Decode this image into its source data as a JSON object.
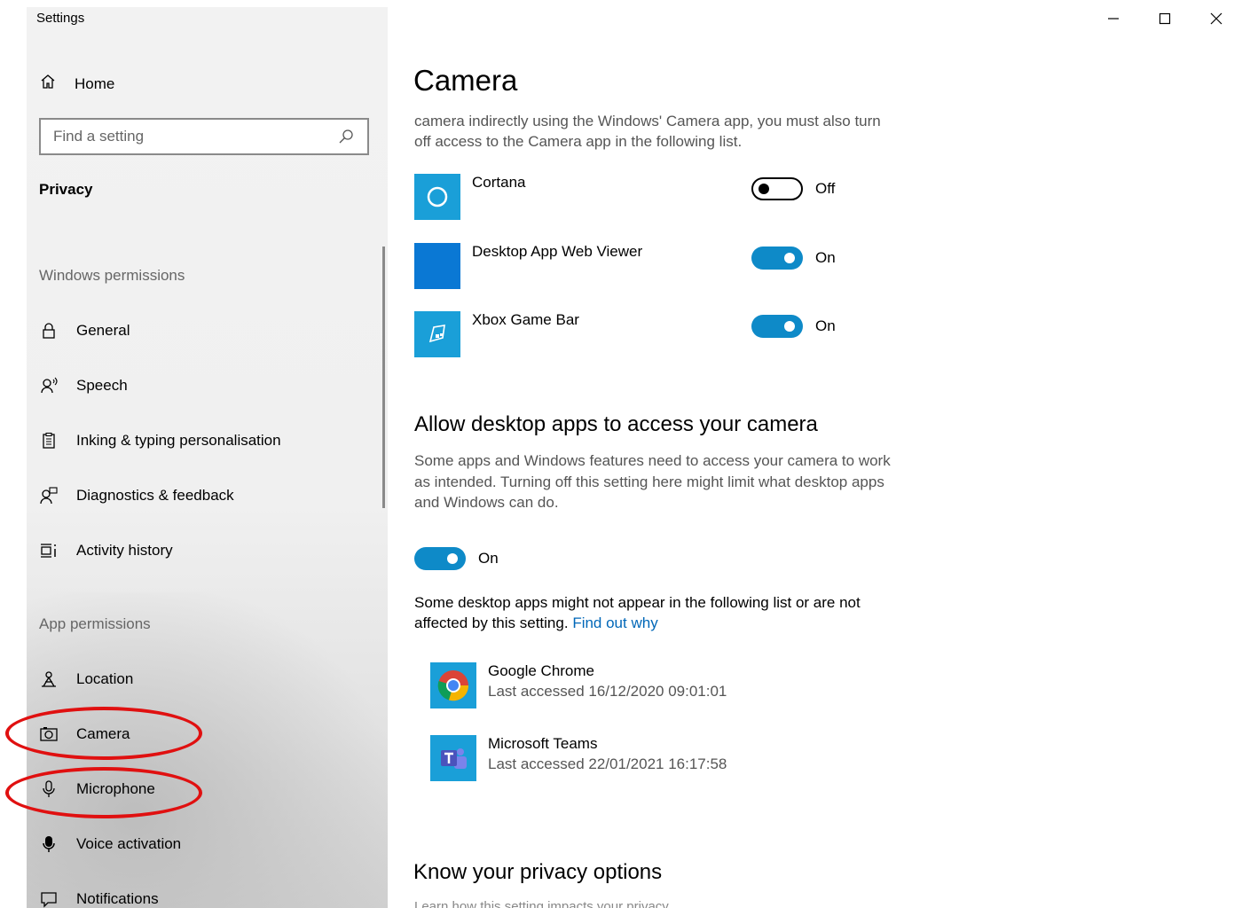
{
  "window": {
    "title": "Settings",
    "controls": {
      "minimize_icon": "minimize-icon",
      "maximize_icon": "maximize-icon",
      "close_icon": "close-icon"
    }
  },
  "sidebar": {
    "home_label": "Home",
    "search": {
      "placeholder": "Find a setting"
    },
    "section_title": "Privacy",
    "windows_permissions_label": "Windows permissions",
    "windows_permissions": [
      {
        "label": "General",
        "icon": "lock-icon"
      },
      {
        "label": "Speech",
        "icon": "speech-icon"
      },
      {
        "label": "Inking & typing personalisation",
        "icon": "clipboard-icon"
      },
      {
        "label": "Diagnostics & feedback",
        "icon": "feedback-icon"
      },
      {
        "label": "Activity history",
        "icon": "history-icon"
      }
    ],
    "app_permissions_label": "App permissions",
    "app_permissions": [
      {
        "label": "Location",
        "icon": "location-icon"
      },
      {
        "label": "Camera",
        "icon": "camera-icon",
        "highlighted": true
      },
      {
        "label": "Microphone",
        "icon": "microphone-icon",
        "highlighted": true
      },
      {
        "label": "Voice activation",
        "icon": "voice-activation-icon"
      },
      {
        "label": "Notifications",
        "icon": "notifications-icon"
      }
    ],
    "highlight_color": "#e01010"
  },
  "main": {
    "title": "Camera",
    "intro_line1": "camera indirectly using the Windows' Camera app, you must also turn",
    "intro_line2": "off access to the Camera app in the following list.",
    "apps": [
      {
        "name": "Cortana",
        "state": "Off",
        "on": false,
        "tile_color": "#1a9fd8"
      },
      {
        "name": "Desktop App Web Viewer",
        "state": "On",
        "on": true,
        "tile_color": "#0a78d4"
      },
      {
        "name": "Xbox Game Bar",
        "state": "On",
        "on": true,
        "tile_color": "#1a9fd8"
      }
    ],
    "desktop_section": {
      "heading": "Allow desktop apps to access your camera",
      "desc_line1": "Some apps and Windows features need to access your camera to work",
      "desc_line2": "as intended. Turning off this setting here might limit what desktop apps",
      "desc_line3": "and Windows can do.",
      "toggle_state": "On",
      "note_line1": "Some desktop apps might not appear in the following list or are not",
      "note_line2_prefix": "affected by this setting.",
      "note_link": "Find out why",
      "apps": [
        {
          "name": "Google Chrome",
          "last_accessed": "Last accessed 16/12/2020 09:01:01"
        },
        {
          "name": "Microsoft Teams",
          "last_accessed": "Last accessed 22/01/2021 16:17:58"
        }
      ]
    },
    "privacy_section": {
      "heading": "Know your privacy options",
      "desc_partial": "Learn how this setting impacts your privacy."
    },
    "accent_color": "#0e8ac8",
    "link_color": "#0067b8"
  }
}
